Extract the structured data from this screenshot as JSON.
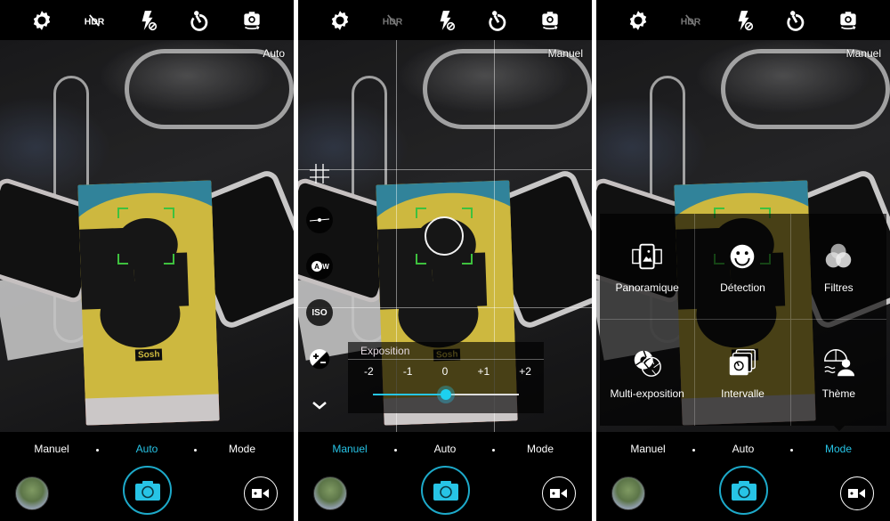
{
  "colors": {
    "accent": "#27c4e6",
    "focus": "#3ec13e",
    "background": "#000000"
  },
  "topbar_icons": [
    {
      "name": "settings-icon",
      "state": "on"
    },
    {
      "name": "hdr-off-icon",
      "label": "HDR",
      "state": "off"
    },
    {
      "name": "flash-off-icon",
      "state": "off"
    },
    {
      "name": "timer-icon",
      "state": "on"
    },
    {
      "name": "switch-camera-icon",
      "state": "on"
    }
  ],
  "modes": {
    "labels": [
      "Manuel",
      "Auto",
      "Mode"
    ]
  },
  "panels": [
    {
      "current_mode_label": "Auto",
      "active_mode": "Auto",
      "hdr_dimmed": false
    },
    {
      "current_mode_label": "Manuel",
      "active_mode": "Manuel",
      "hdr_dimmed": true,
      "side_tools": [
        {
          "name": "grid-icon"
        },
        {
          "name": "focus-slider-icon"
        },
        {
          "name": "white-balance-icon",
          "label": "AW"
        },
        {
          "name": "iso-icon",
          "label": "ISO"
        },
        {
          "name": "exposure-icon"
        },
        {
          "name": "collapse-chevron-icon"
        }
      ],
      "exposure": {
        "title": "Exposition",
        "ticks": [
          "-2",
          "-1",
          "0",
          "+1",
          "+2"
        ],
        "min": -2,
        "max": 2,
        "value": 0
      }
    },
    {
      "current_mode_label": "Manuel",
      "active_mode": "Mode",
      "hdr_dimmed": true,
      "mode_menu": [
        {
          "label": "Panoramique",
          "icon": "panorama-icon"
        },
        {
          "label": "Détection",
          "icon": "smile-detection-icon"
        },
        {
          "label": "Filtres",
          "icon": "filters-icon"
        },
        {
          "label": "Multi-exposition",
          "icon": "multi-exposure-icon"
        },
        {
          "label": "Intervalle",
          "icon": "interval-timer-icon"
        },
        {
          "label": "Thème",
          "icon": "theme-icon"
        }
      ]
    }
  ],
  "viewfinder": {
    "box_brand": "Sosh"
  }
}
